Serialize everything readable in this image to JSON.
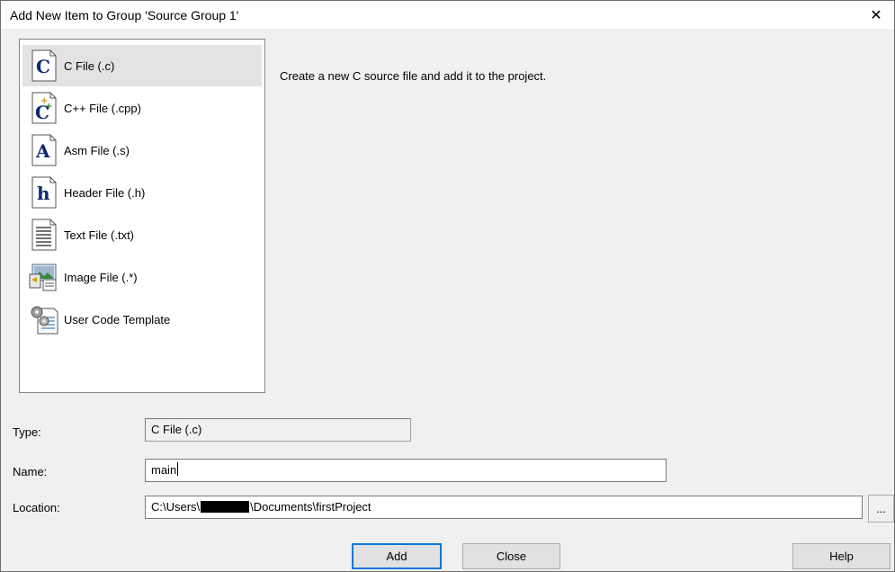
{
  "window": {
    "title": "Add New Item to Group 'Source Group 1'",
    "close_glyph": "✕"
  },
  "item_list": [
    {
      "label": "C File (.c)",
      "icon": "c-file-icon",
      "selected": true
    },
    {
      "label": "C++ File (.cpp)",
      "icon": "cpp-file-icon",
      "selected": false
    },
    {
      "label": "Asm File (.s)",
      "icon": "asm-file-icon",
      "selected": false
    },
    {
      "label": "Header File (.h)",
      "icon": "header-file-icon",
      "selected": false
    },
    {
      "label": "Text File (.txt)",
      "icon": "text-file-icon",
      "selected": false
    },
    {
      "label": "Image File (.*)",
      "icon": "image-file-icon",
      "selected": false
    },
    {
      "label": "User Code Template",
      "icon": "user-code-template-icon",
      "selected": false
    }
  ],
  "description": "Create a new C source file and add it to the project.",
  "form": {
    "type_label": "Type:",
    "type_value": "C File (.c)",
    "name_label": "Name:",
    "name_value": "main",
    "location_label": "Location:",
    "location_prefix": "C:\\Users\\",
    "location_suffix": "\\Documents\\firstProject",
    "browse_label": "..."
  },
  "buttons": {
    "add": "Add",
    "close": "Close",
    "help": "Help"
  },
  "colors": {
    "icon_blue": "#0a2a6e",
    "default_button_border": "#0078d7"
  }
}
